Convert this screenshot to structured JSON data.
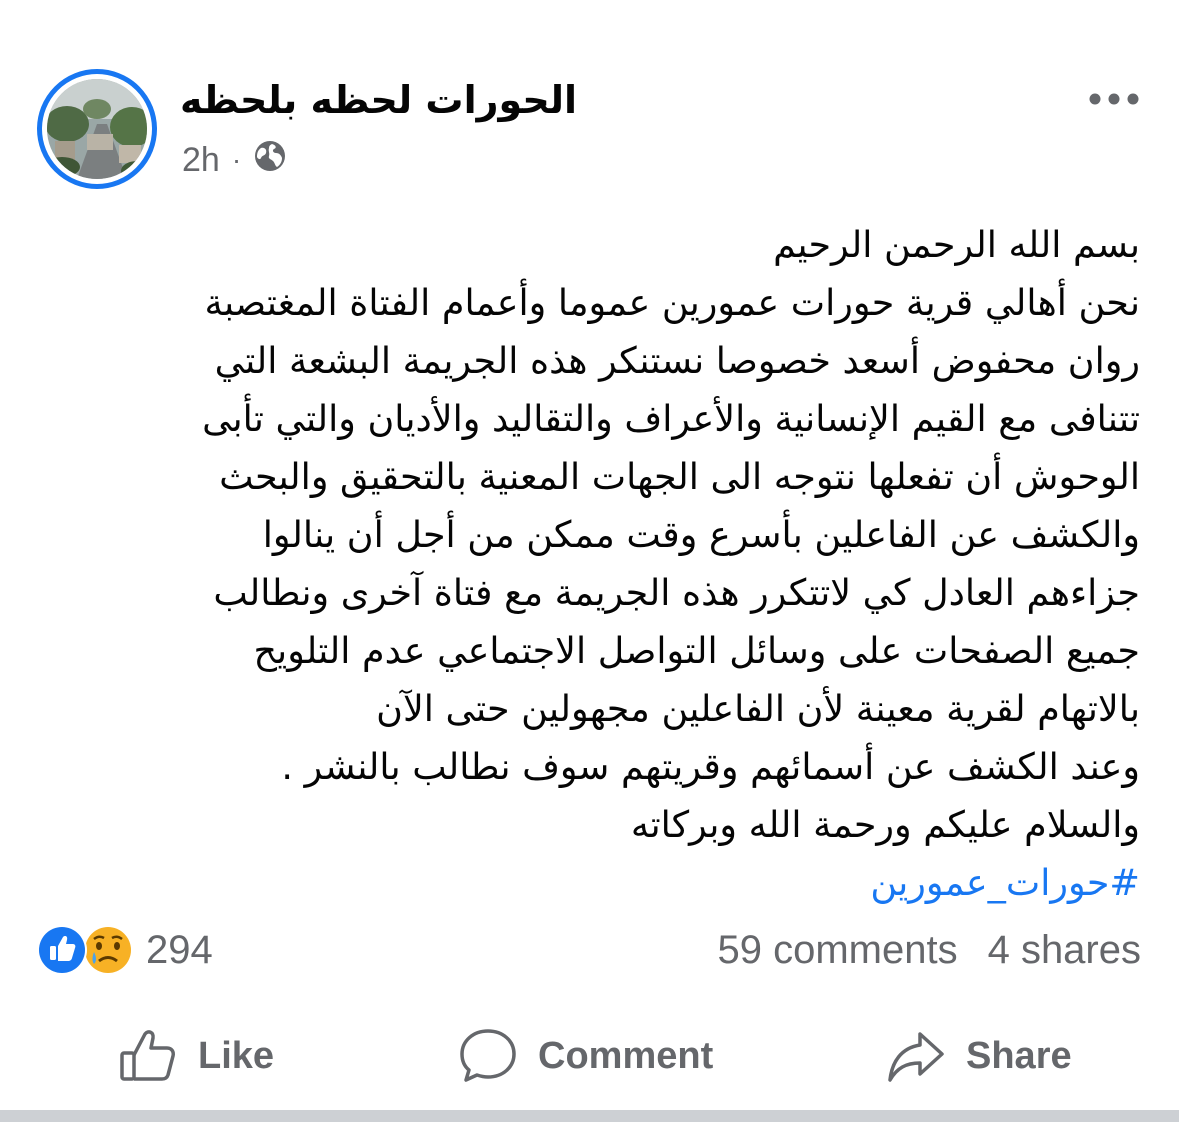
{
  "post": {
    "page_name": "الحورات لحظه بلحظه",
    "time": "2h",
    "separator": "·",
    "privacy_icon": "globe-icon",
    "more_icon": "more-dots-icon",
    "lines": [
      "بسم الله الرحمن الرحيم",
      "نحن أهالي قرية حورات عمورين عموما وأعمام الفتاة المغتصبة",
      "روان محفوض أسعد خصوصا نستنكر هذه الجريمة البشعة التي",
      "تتنافى مع القيم الإنسانية والأعراف والتقاليد والأديان والتي تأبى",
      "الوحوش أن تفعلها نتوجه الى الجهات المعنية بالتحقيق والبحث",
      "والكشف عن الفاعلين بأسرع وقت ممكن من أجل أن ينالوا",
      "جزاءهم العادل كي لاتتكرر هذه الجريمة مع فتاة آخرى ونطالب",
      "جميع الصفحات على وسائل التواصل الاجتماعي عدم التلويح",
      "بالاتهام لقرية معينة لأن الفاعلين مجهولين حتى الآن",
      "وعند الكشف عن أسمائهم وقريتهم سوف نطالب بالنشر .",
      "والسلام عليكم ورحمة الله وبركاته"
    ],
    "hashtag": "#حورات_عمورين"
  },
  "stats": {
    "reactions_count": "294",
    "reaction_icons": [
      "like-icon",
      "sad-icon"
    ],
    "comments": "59 comments",
    "shares": "4 shares"
  },
  "actions": {
    "like": "Like",
    "comment": "Comment",
    "share": "Share"
  },
  "colors": {
    "accent": "#1877f2",
    "secondary_text": "#65676b",
    "primary_text": "#050505"
  }
}
